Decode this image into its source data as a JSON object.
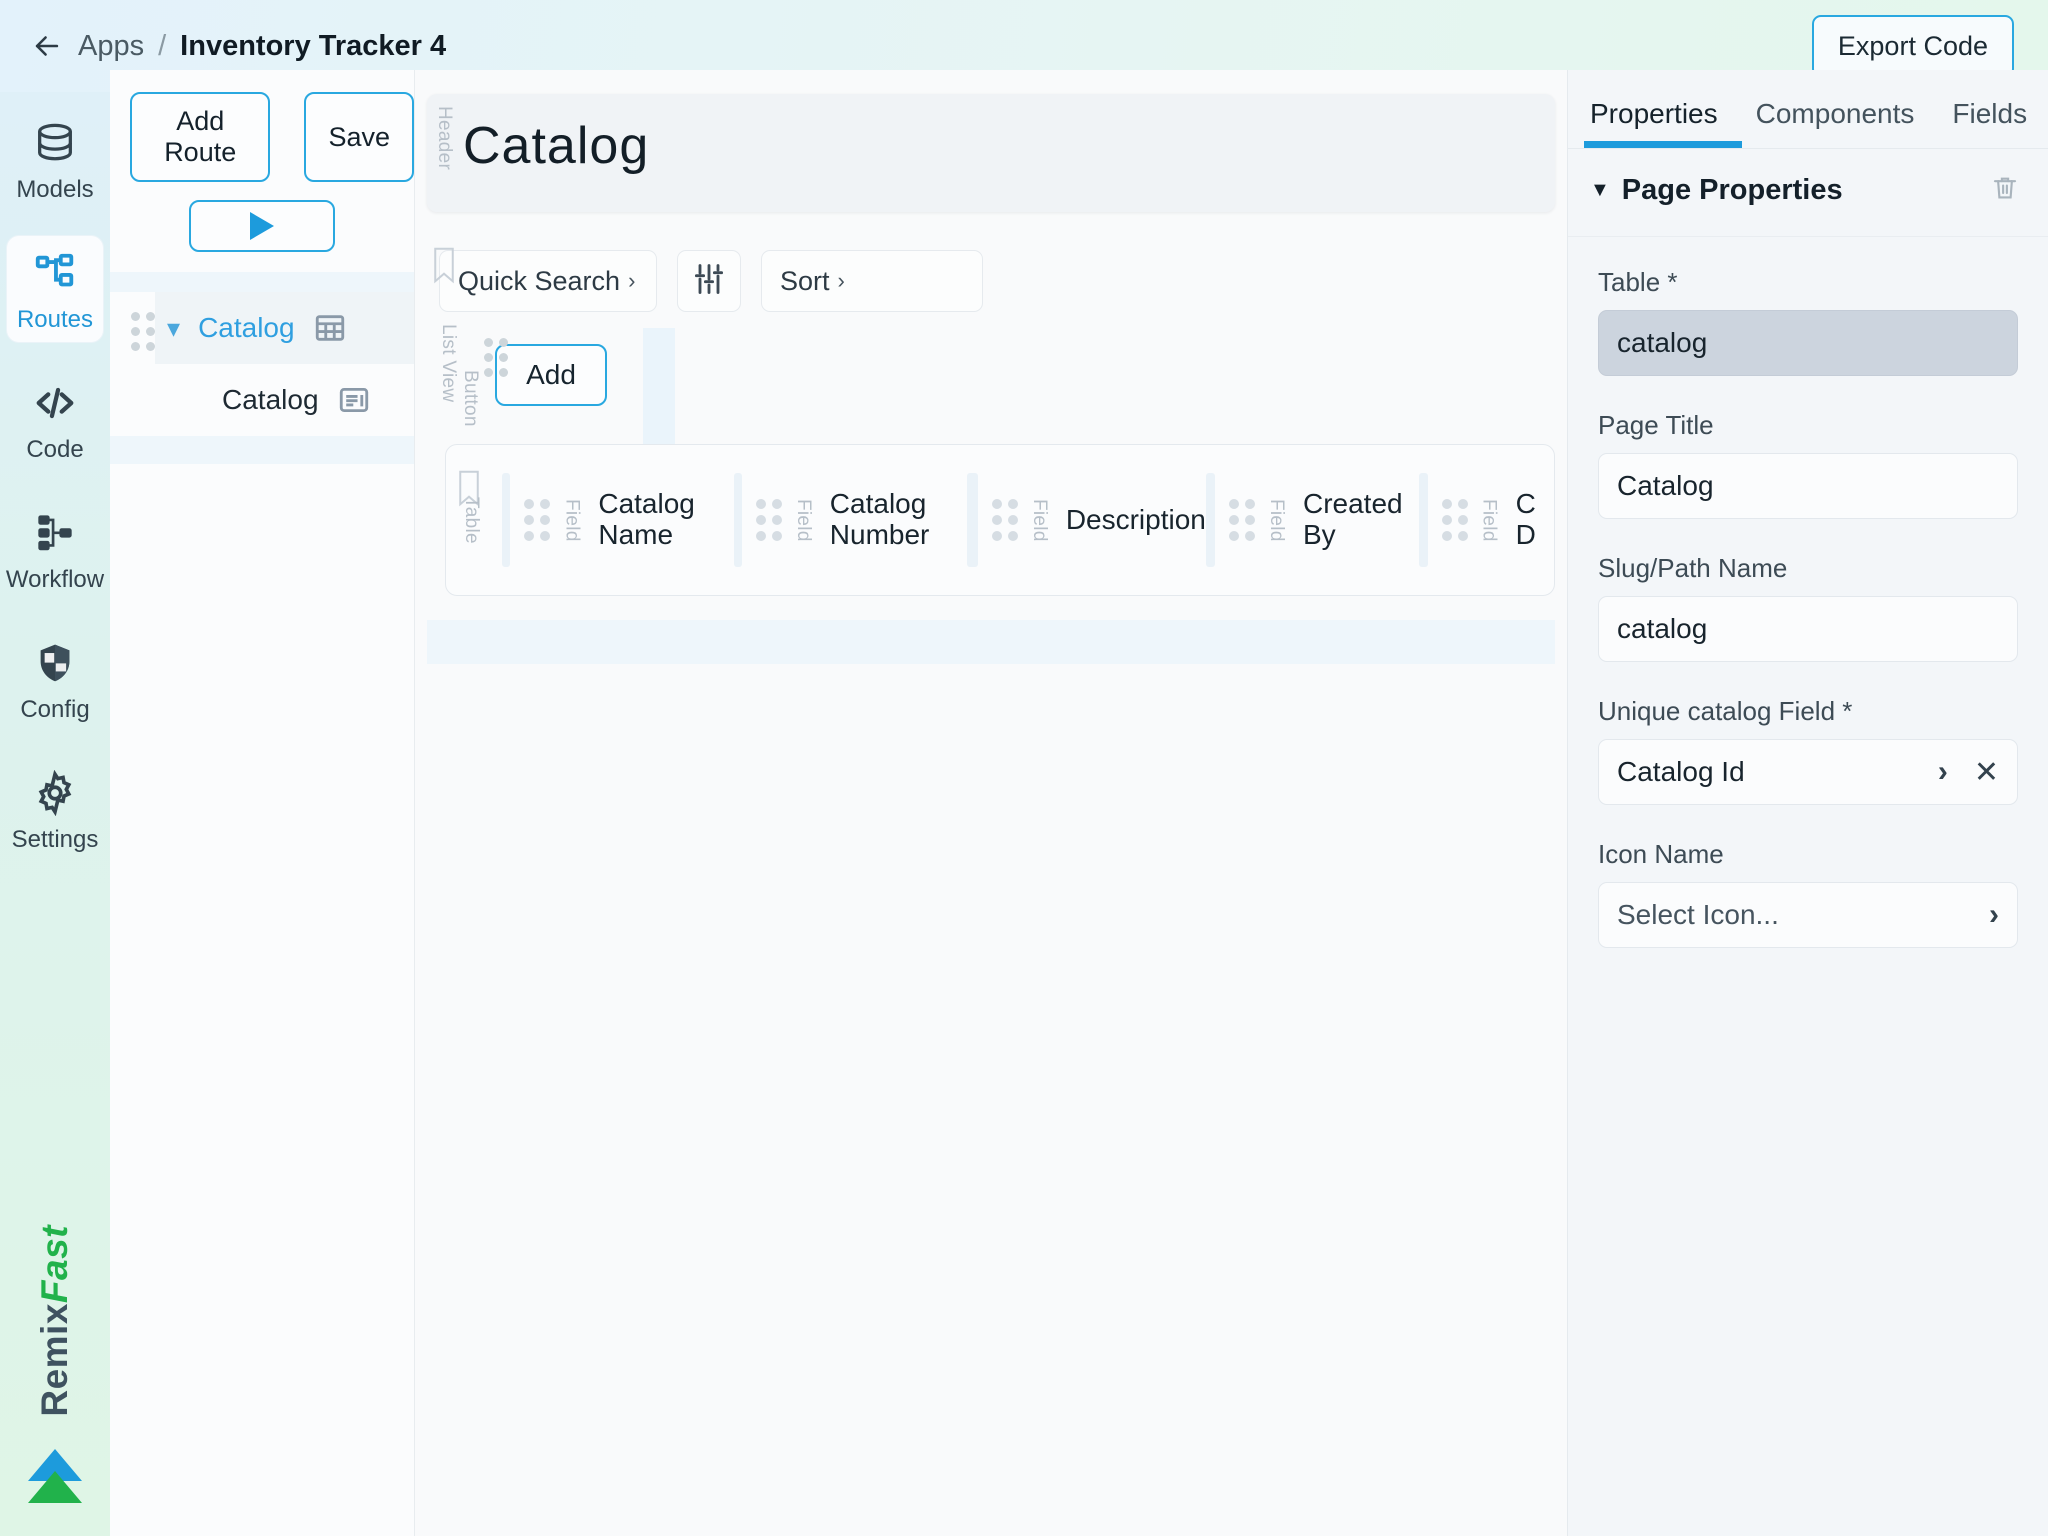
{
  "topbar": {
    "back_icon": "arrow-left-icon",
    "breadcrumb_root": "Apps",
    "breadcrumb_sep": "/",
    "app_name": "Inventory Tracker 4",
    "export_label": "Export Code"
  },
  "rail": {
    "items": [
      {
        "label": "Models",
        "icon": "database-icon",
        "active": false
      },
      {
        "label": "Routes",
        "icon": "sitemap-icon",
        "active": true
      },
      {
        "label": "Code",
        "icon": "code-brackets-icon",
        "active": false
      },
      {
        "label": "Workflow",
        "icon": "workflow-icon",
        "active": false
      },
      {
        "label": "Config",
        "icon": "shield-icon",
        "active": false
      },
      {
        "label": "Settings",
        "icon": "gear-icon",
        "active": false
      }
    ],
    "brand_part1": "Remix",
    "brand_part2": "Fast"
  },
  "routes": {
    "add_route_label": "Add Route",
    "save_label": "Save",
    "run_icon": "play-icon",
    "tree": [
      {
        "label": "Catalog",
        "icon": "table-grid-icon",
        "selected": true,
        "expanded": true
      },
      {
        "label": "Catalog",
        "icon": "list-view-icon",
        "selected": false,
        "child": true
      }
    ]
  },
  "canvas": {
    "header_zone_label": "Header",
    "page_heading": "Catalog",
    "toolbar": {
      "quick_search_label": "Quick Search",
      "quick_search_chevron": "›",
      "filter_icon": "sliders-icon",
      "sort_label": "Sort",
      "sort_chevron": "›"
    },
    "listview_zone_label": "List View",
    "button_zone_label": "Button",
    "add_button_label": "Add",
    "table_zone_label": "Table",
    "field_zone_label": "Field",
    "columns": [
      {
        "name": "Catalog Name"
      },
      {
        "name": "Catalog Number"
      },
      {
        "name": "Description"
      },
      {
        "name": "Created By"
      },
      {
        "name": "C D"
      }
    ]
  },
  "properties": {
    "tabs": [
      {
        "label": "Properties",
        "active": true
      },
      {
        "label": "Components",
        "active": false
      },
      {
        "label": "Fields",
        "active": false
      }
    ],
    "section_title": "Page Properties",
    "section_caret": "▼",
    "delete_icon": "trash-icon",
    "fields": [
      {
        "label": "Table *",
        "value": "catalog",
        "style": "filled"
      },
      {
        "label": "Page Title",
        "value": "Catalog",
        "style": "plain"
      },
      {
        "label": "Slug/Path Name",
        "value": "catalog",
        "style": "plain"
      },
      {
        "label": "Unique catalog Field *",
        "value": "Catalog Id",
        "style": "chevron-clear"
      },
      {
        "label": "Icon Name",
        "value": "Select Icon...",
        "style": "chevron"
      }
    ]
  },
  "colors": {
    "accent": "#1d9bdc",
    "brand_green": "#21b24b",
    "text_dark": "#14202a"
  }
}
